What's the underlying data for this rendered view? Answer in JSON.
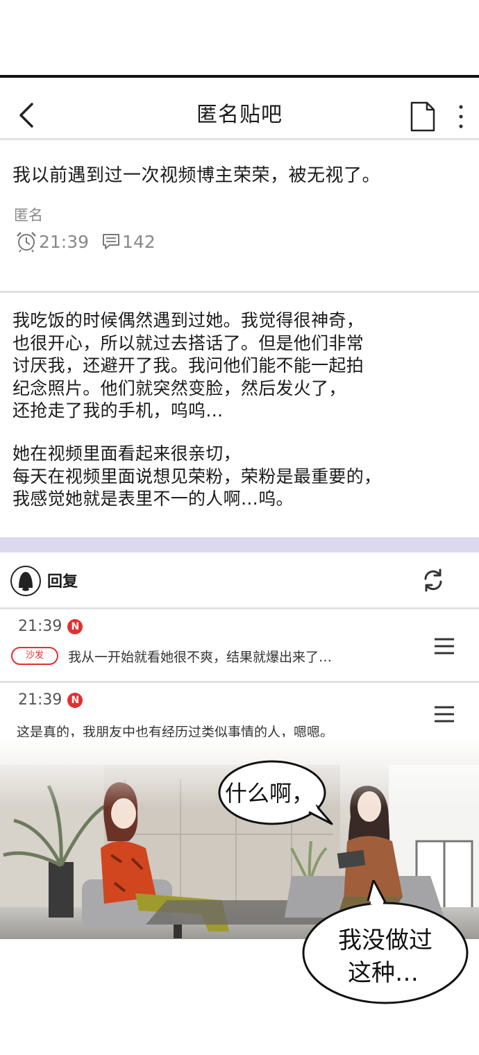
{
  "header": {
    "title": "匿名贴吧",
    "back_icon": "chevron-left-icon",
    "doc_icon": "document-icon",
    "more_icon": "more-vertical-icon"
  },
  "post": {
    "title": "我以前遇到过一次视频博主荣荣，被无视了。",
    "author": "匿名",
    "time": "21:39",
    "comment_count": "142",
    "paragraphs": [
      "我吃饭的时候偶然遇到过她。我觉得很神奇，\n也很开心，所以就过去搭话了。但是他们非常\n讨厌我，还避开了我。我问他们能不能一起拍\n纪念照片。他们就突然变脸，然后发火了，\n还抢走了我的手机，呜呜…",
      "她在视频里面看起来很亲切，\n每天在视频里面说想见荣粉，荣粉是最重要的，\n我感觉她就是表里不一的人啊…呜。"
    ]
  },
  "replies_section": {
    "label": "回复",
    "icon": "bell-icon",
    "refresh_icon": "refresh-icon"
  },
  "replies": [
    {
      "time": "21:39",
      "badge": "N",
      "tag": "沙发",
      "text": "我从一开始就看她很不爽，结果就爆出来了…"
    },
    {
      "time": "21:39",
      "badge": "N",
      "text": "这是真的，我朋友中也有经历过类似事情的人，嗯嗯。"
    }
  ],
  "comic": {
    "bubble1": "什么啊，",
    "bubble2_line1": "我没做过",
    "bubble2_line2": "这种…"
  },
  "colors": {
    "accent_red": "#e23030",
    "separator": "#e2e2e2",
    "lilac": "#dcd8ee"
  }
}
